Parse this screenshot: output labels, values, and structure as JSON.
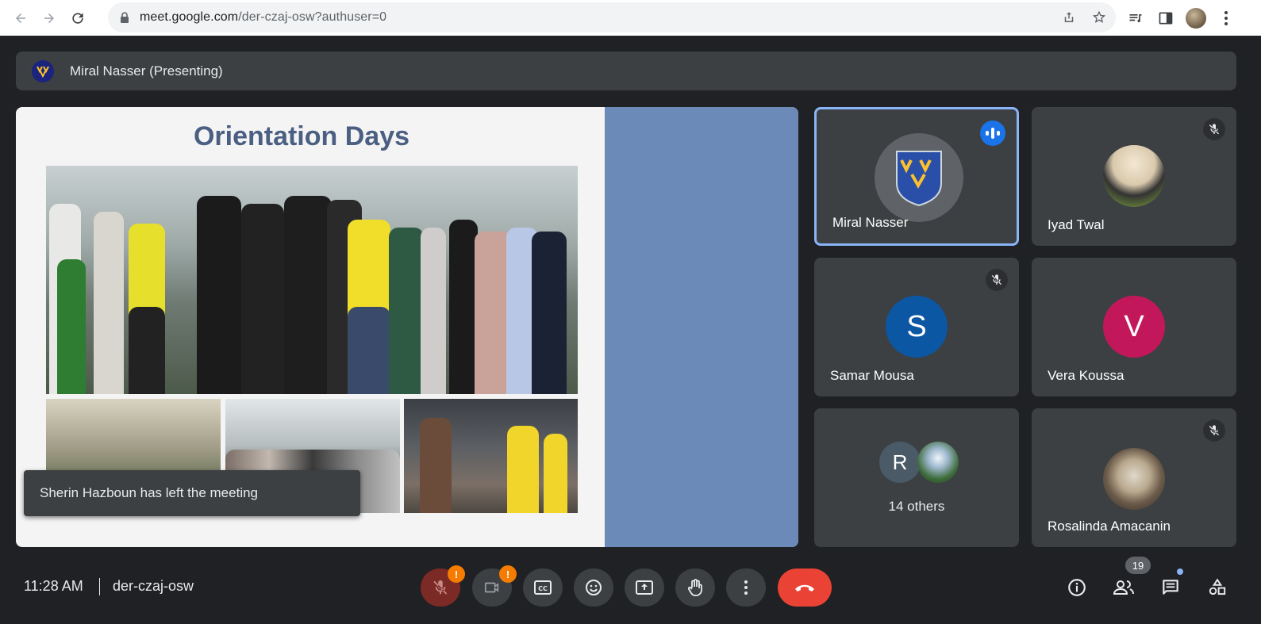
{
  "browser": {
    "url_host": "meet.google.com",
    "url_path": "/der-czaj-osw?authuser=0"
  },
  "presenter": {
    "label": "Miral Nasser (Presenting)"
  },
  "slide": {
    "title": "Orientation Days"
  },
  "toast": {
    "message": "Sherin Hazboun has left the meeting"
  },
  "participants": [
    {
      "name": "Miral Nasser",
      "state": "speaking"
    },
    {
      "name": "Iyad Twal",
      "state": "muted"
    },
    {
      "name": "Samar Mousa",
      "initial": "S",
      "color": "#0b57a4",
      "state": "muted"
    },
    {
      "name": "Vera Koussa",
      "initial": "V",
      "color": "#c2185b",
      "state": "unmuted"
    },
    {
      "group_label": "14 others",
      "initial": "R"
    },
    {
      "name": "Rosalinda Amacanin",
      "state": "muted"
    }
  ],
  "bottom": {
    "time": "11:28 AM",
    "meeting_code": "der-czaj-osw",
    "people_count": "19",
    "warning_mark": "!"
  },
  "colors": {
    "background": "#202124",
    "tile": "#3c4043",
    "active_border": "#8ab4f8",
    "end_call": "#ea4335",
    "slide_accent": "#6b8ab7"
  }
}
